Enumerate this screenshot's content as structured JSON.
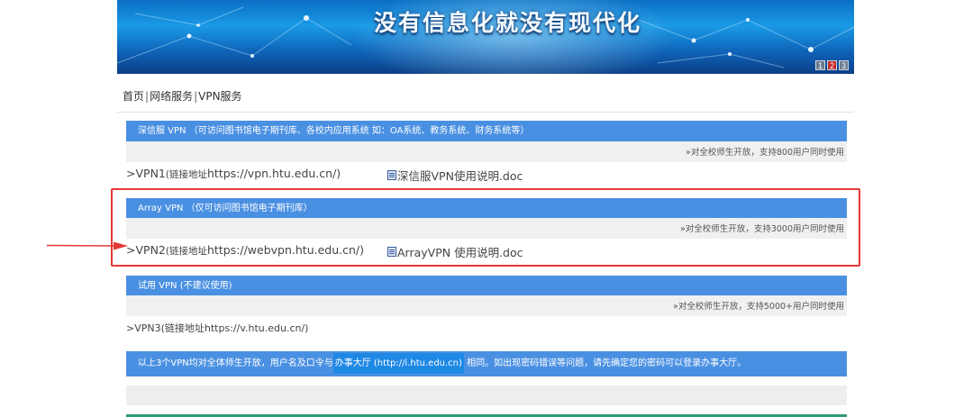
{
  "banner": {
    "title": "没有信息化就没有现代化",
    "slides": [
      "1",
      "2",
      "3"
    ],
    "active_slide": "2"
  },
  "breadcrumb": {
    "home": "首页",
    "network": "网络服务",
    "vpn": "VPN服务",
    "separator": "|"
  },
  "sections": [
    {
      "header": "深信服 VPN （可访问图书馆电子期刊库、各校内应用系统 如：OA系统、教务系统、财务系统等）",
      "note": "»对全校师生开放，支持800用户同时使用",
      "link_prefix": ">",
      "link_name": "VPN1",
      "link_label": "(链接地址",
      "link_url": "https://vpn.htu.edu.cn/)",
      "doc": "深信服VPN使用说明.doc"
    },
    {
      "header": "Array VPN （仅可访问图书馆电子期刊库）",
      "note": "»对全校师生开放，支持3000用户同时使用",
      "link_prefix": ">",
      "link_name": "VPN2",
      "link_label": "(链接地址",
      "link_url": "https://webvpn.htu.edu.cn/)",
      "doc": "ArrayVPN 使用说明.doc"
    },
    {
      "header": "试用 VPN (不建议使用)",
      "note": "»对全校师生开放，支持5000+用户同时使用",
      "link_prefix": ">",
      "link_name": "VPN3",
      "link_label": "(链接地址https://v.htu.edu.cn/)"
    }
  ],
  "info": {
    "before": "以上3个VPN均对全体师生开放，用户名及口令与",
    "highlight": "办事大厅 (http://i.htu.edu.cn)",
    "after": " 相同。如出现密码错误等问题，请先确定您的密码可以登录办事大厅。"
  },
  "colors": {
    "header_blue": "#4a90e2",
    "highlight_red": "#e53935",
    "banner_blue": "#1a9ae6"
  }
}
